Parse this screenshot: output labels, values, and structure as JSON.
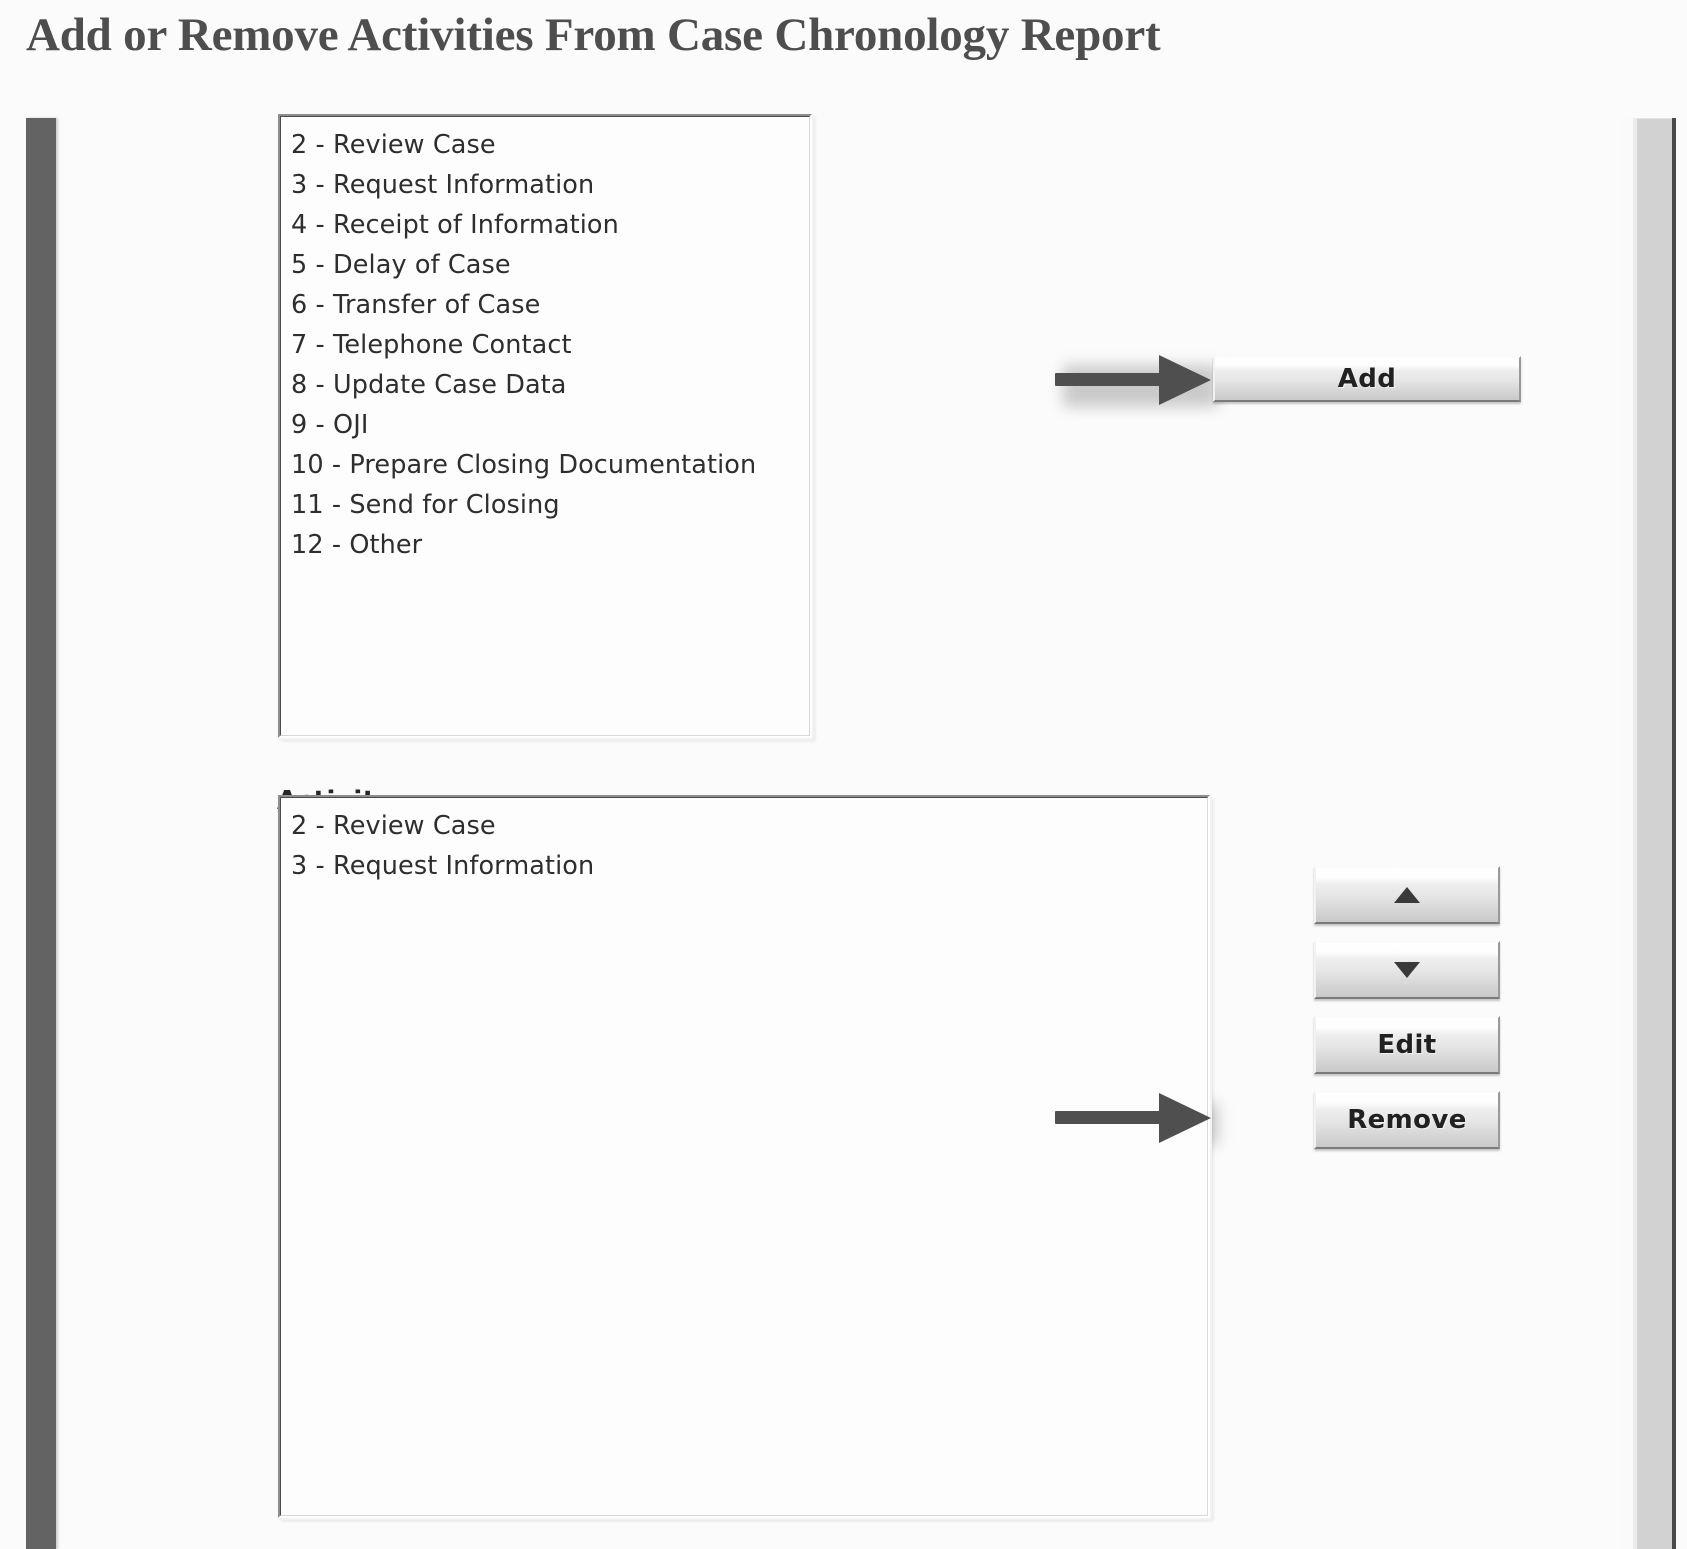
{
  "page": {
    "title": "Add or Remove Activities From Case Chronology Report",
    "accent_color": "#4e4e4e",
    "rail_color": "#636363",
    "scrollbar_color": "#d2d2d2"
  },
  "source_list": {
    "name": "activity-master-list",
    "items": [
      "2 - Review Case",
      "3 - Request Information",
      "4 - Receipt of Information",
      "5 - Delay of Case",
      "6 - Transfer of Case",
      "7 - Telephone Contact",
      "8 - Update Case Data",
      "9 - OJI",
      "10 - Prepare Closing Documentation",
      "11 - Send for Closing",
      "12 - Other"
    ]
  },
  "activity_section": {
    "label": "Activity :",
    "items": [
      "2 - Review Case",
      "3 - Request Information"
    ]
  },
  "buttons": {
    "add": "Add",
    "move_up": "▲",
    "move_down": "▼",
    "edit": "Edit",
    "remove": "Remove"
  },
  "annotations": [
    {
      "name": "add-arrow",
      "points_to": "Add"
    },
    {
      "name": "remove-arrow",
      "points_to": "Remove"
    }
  ]
}
